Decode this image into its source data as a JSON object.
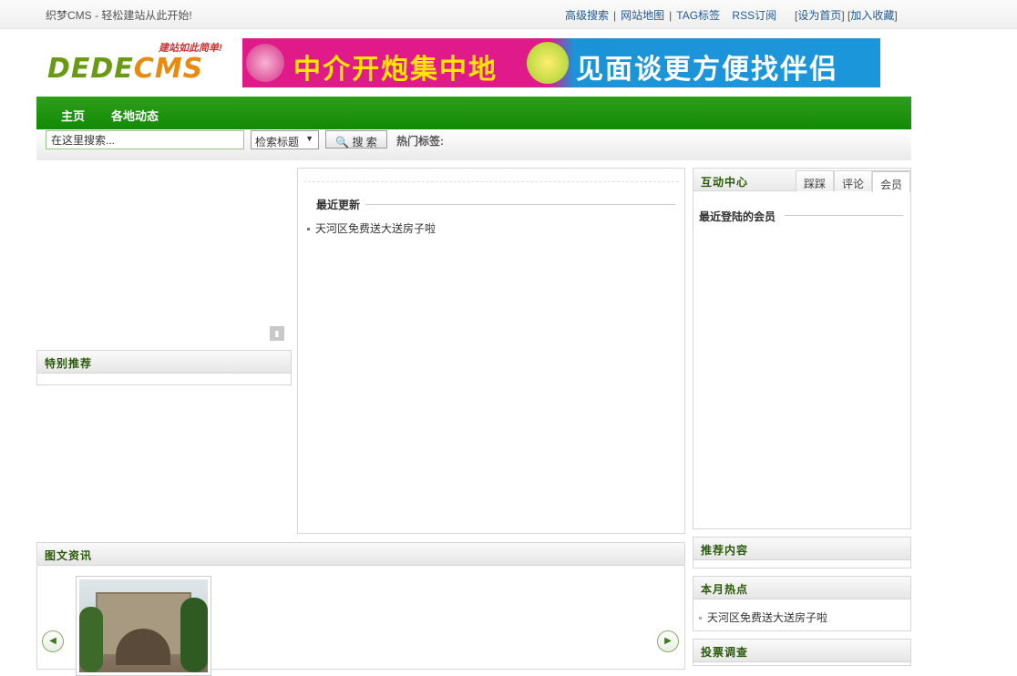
{
  "topbar": {
    "slogan": "织梦CMS - 轻松建站从此开始!",
    "links": [
      "高级搜索",
      "网站地图",
      "TAG标签",
      "RSS订阅"
    ],
    "set_home": "设为首页",
    "add_fav": "加入收藏"
  },
  "header": {
    "logo_tagline": "建站如此简单!",
    "logo_text_1": "DEDE",
    "logo_text_2": "CMS",
    "banner_text_1": "中介开炮集中地",
    "banner_text_2": "见面谈更方便找伴侣"
  },
  "nav": {
    "items": [
      "主页",
      "各地动态"
    ]
  },
  "search": {
    "input_value": "在这里搜索...",
    "select_value": "检索标题",
    "button_label": "搜 索",
    "hot_tags_label": "热门标签:"
  },
  "left": {
    "special_title": "特别推荐",
    "pic_title": "图文资讯"
  },
  "center": {
    "latest_title": "最近更新",
    "latest_items": [
      "天河区免费送大送房子啦"
    ]
  },
  "interact": {
    "title": "互动中心",
    "tabs": [
      "踩踩",
      "评论",
      "会员"
    ],
    "active_tab": "会员",
    "members_title": "最近登陆的会员"
  },
  "right": {
    "recommend_title": "推荐内容",
    "hot_title": "本月热点",
    "hot_items": [
      "天河区免费送大送房子啦"
    ],
    "vote_title": "投票调查"
  },
  "colors": {
    "nav_green": "#118a06",
    "link_blue": "#1f5a93",
    "header_green": "#2a5a0a"
  }
}
